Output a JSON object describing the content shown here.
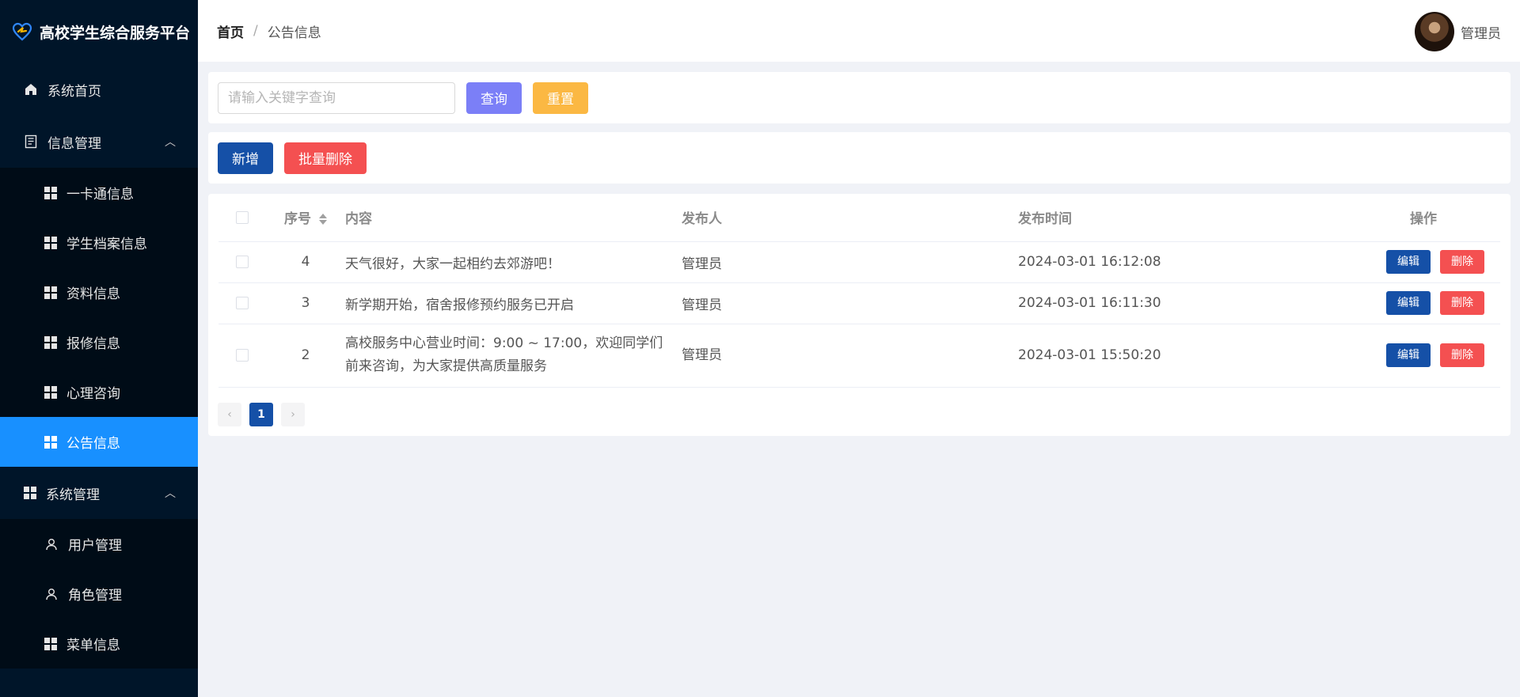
{
  "app": {
    "title": "高校学生综合服务平台"
  },
  "sidebar": {
    "home": "系统首页",
    "info_group": {
      "label": "信息管理",
      "items": [
        "一卡通信息",
        "学生档案信息",
        "资料信息",
        "报修信息",
        "心理咨询",
        "公告信息"
      ]
    },
    "sys_group": {
      "label": "系统管理",
      "items": [
        "用户管理",
        "角色管理",
        "菜单信息"
      ]
    },
    "active_item": "公告信息"
  },
  "header": {
    "breadcrumb_home": "首页",
    "breadcrumb_sep": "/",
    "breadcrumb_current": "公告信息",
    "user_name": "管理员"
  },
  "search": {
    "placeholder": "请输入关键字查询",
    "query_label": "查询",
    "reset_label": "重置"
  },
  "actions": {
    "add_label": "新增",
    "bulk_delete_label": "批量删除"
  },
  "table": {
    "headers": {
      "seq": "序号",
      "content": "内容",
      "publisher": "发布人",
      "time": "发布时间",
      "ops": "操作"
    },
    "rows": [
      {
        "seq": "4",
        "content": "天气很好，大家一起相约去郊游吧！",
        "publisher": "管理员",
        "time": "2024-03-01 16:12:08",
        "edit": "编辑",
        "delete": "删除"
      },
      {
        "seq": "3",
        "content": "新学期开始，宿舍报修预约服务已开启",
        "publisher": "管理员",
        "time": "2024-03-01 16:11:30",
        "edit": "编辑",
        "delete": "删除"
      },
      {
        "seq": "2",
        "content": "高校服务中心营业时间：9:00 ~ 17:00，欢迎同学们前来咨询，为大家提供高质量服务",
        "publisher": "管理员",
        "time": "2024-03-01 15:50:20",
        "edit": "编辑",
        "delete": "删除"
      }
    ]
  },
  "pagination": {
    "prev": "‹",
    "current": "1",
    "next": "›"
  },
  "colors": {
    "sidebar_bg": "#001529",
    "active": "#1890ff",
    "primary": "#1550a7",
    "danger": "#f45051",
    "query": "#7b7ff7",
    "reset": "#fbb843"
  }
}
